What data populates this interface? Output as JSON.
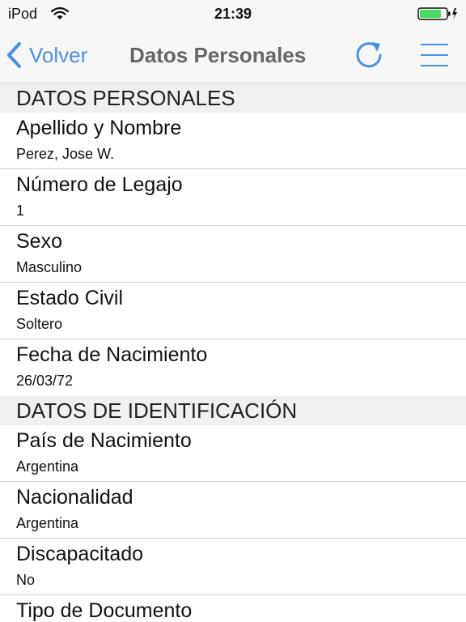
{
  "status_bar": {
    "carrier": "iPod",
    "time": "21:39"
  },
  "nav": {
    "back_label": "Volver",
    "title": "Datos Personales"
  },
  "sections": {
    "personales": {
      "header": "DATOS PERSONALES",
      "rows": [
        {
          "label": "Apellido y Nombre",
          "value": "Perez, Jose W."
        },
        {
          "label": "Número de Legajo",
          "value": "1"
        },
        {
          "label": "Sexo",
          "value": "Masculino"
        },
        {
          "label": "Estado Civil",
          "value": "Soltero"
        },
        {
          "label": "Fecha de Nacimiento",
          "value": "26/03/72"
        }
      ]
    },
    "identificacion": {
      "header": "DATOS DE IDENTIFICACIÓN",
      "rows": [
        {
          "label": "País de Nacimiento",
          "value": "Argentina"
        },
        {
          "label": "Nacionalidad",
          "value": "Argentina"
        },
        {
          "label": "Discapacitado",
          "value": "No"
        },
        {
          "label": "Tipo de Documento",
          "value": ""
        }
      ]
    }
  },
  "colors": {
    "accent": "#4a90e2",
    "bar_background": "#f7f7f7",
    "section_background": "#f0f0f0",
    "battery": "#4cd964"
  },
  "icons": [
    "wifi-icon",
    "battery-icon",
    "chevron-left-icon",
    "refresh-icon",
    "menu-icon"
  ]
}
